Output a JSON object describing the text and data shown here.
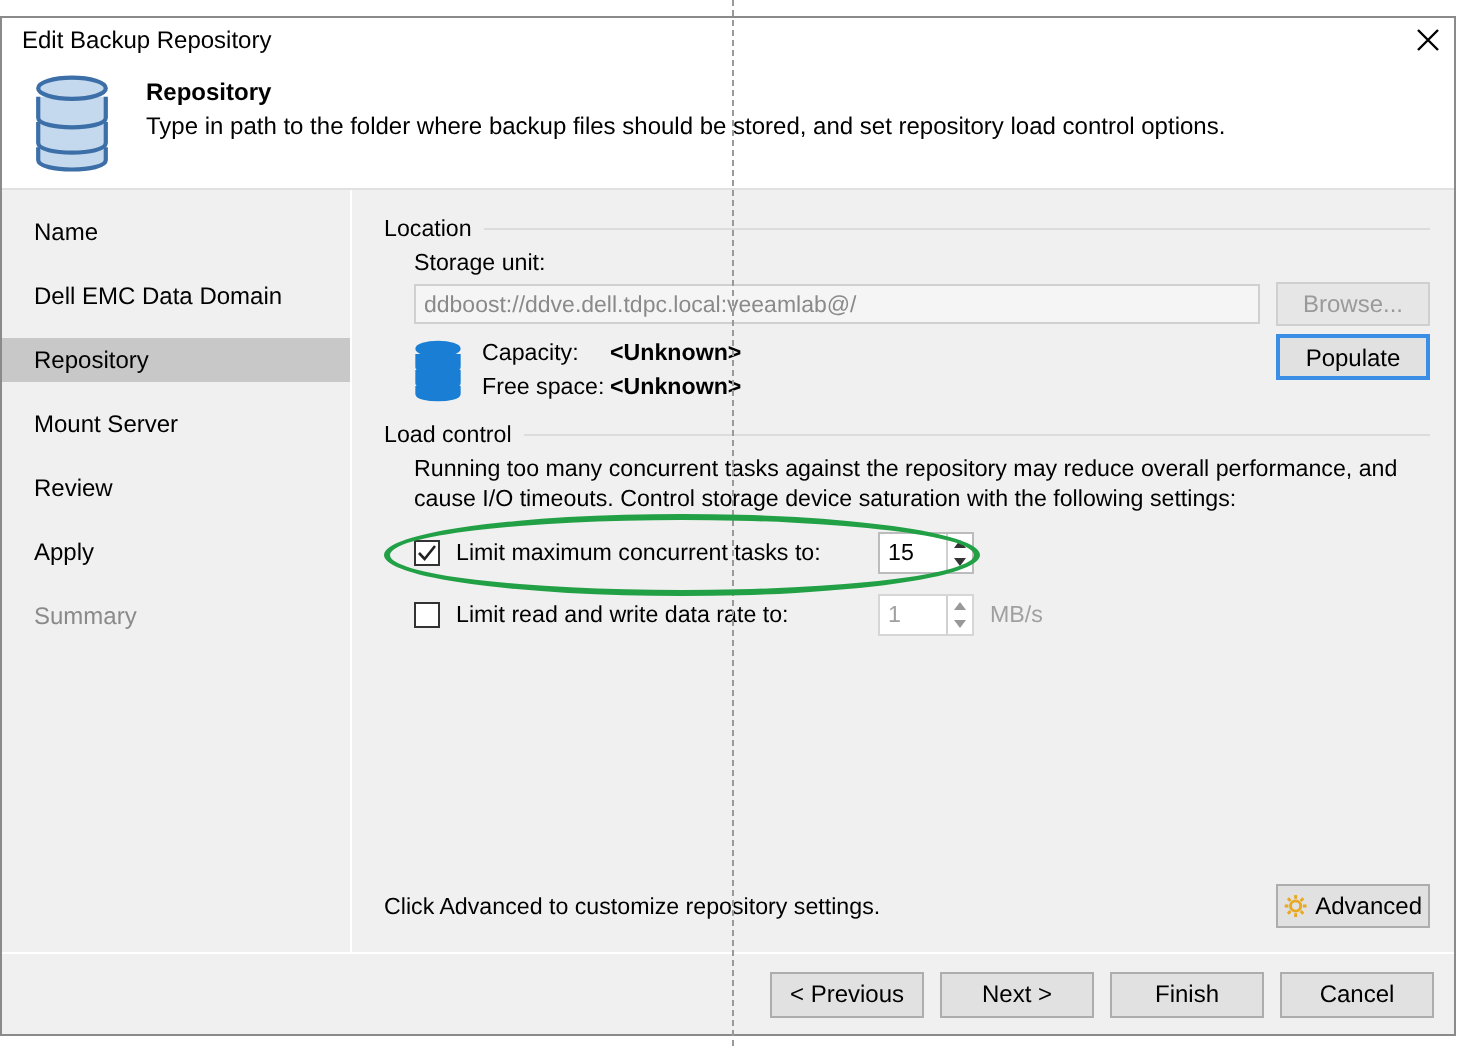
{
  "window": {
    "title": "Edit Backup Repository"
  },
  "header": {
    "title": "Repository",
    "description": "Type in path to the folder where backup files should be stored, and set repository load control options."
  },
  "steps": [
    {
      "label": "Name",
      "selected": false,
      "disabled": false
    },
    {
      "label": "Dell EMC Data Domain",
      "selected": false,
      "disabled": false
    },
    {
      "label": "Repository",
      "selected": true,
      "disabled": false
    },
    {
      "label": "Mount Server",
      "selected": false,
      "disabled": false
    },
    {
      "label": "Review",
      "selected": false,
      "disabled": false
    },
    {
      "label": "Apply",
      "selected": false,
      "disabled": false
    },
    {
      "label": "Summary",
      "selected": false,
      "disabled": true
    }
  ],
  "location": {
    "heading": "Location",
    "storage_label": "Storage unit:",
    "storage_value": "ddboost://ddve.dell.tdpc.local:veeamlab@/",
    "storage_disabled": true,
    "browse": {
      "label": "Browse...",
      "disabled": true
    },
    "populate": "Populate",
    "capacity_label": "Capacity:",
    "capacity_value": "<Unknown>",
    "free_label": "Free space:",
    "free_value": "<Unknown>"
  },
  "load_control": {
    "heading": "Load control",
    "description": "Running too many concurrent tasks against the repository may reduce overall performance, and cause I/O timeouts. Control storage device saturation with the following settings:",
    "limits": [
      {
        "label": "Limit maximum concurrent tasks to:",
        "checked": true,
        "value": "15"
      },
      {
        "label": "Limit read and write data rate to:",
        "checked": false,
        "value": "1",
        "unit": "MB/s"
      }
    ]
  },
  "advanced": {
    "hint": "Click Advanced to customize repository settings.",
    "button": "Advanced"
  },
  "buttons": [
    "< Previous",
    "Next >",
    "Finish",
    "Cancel"
  ]
}
